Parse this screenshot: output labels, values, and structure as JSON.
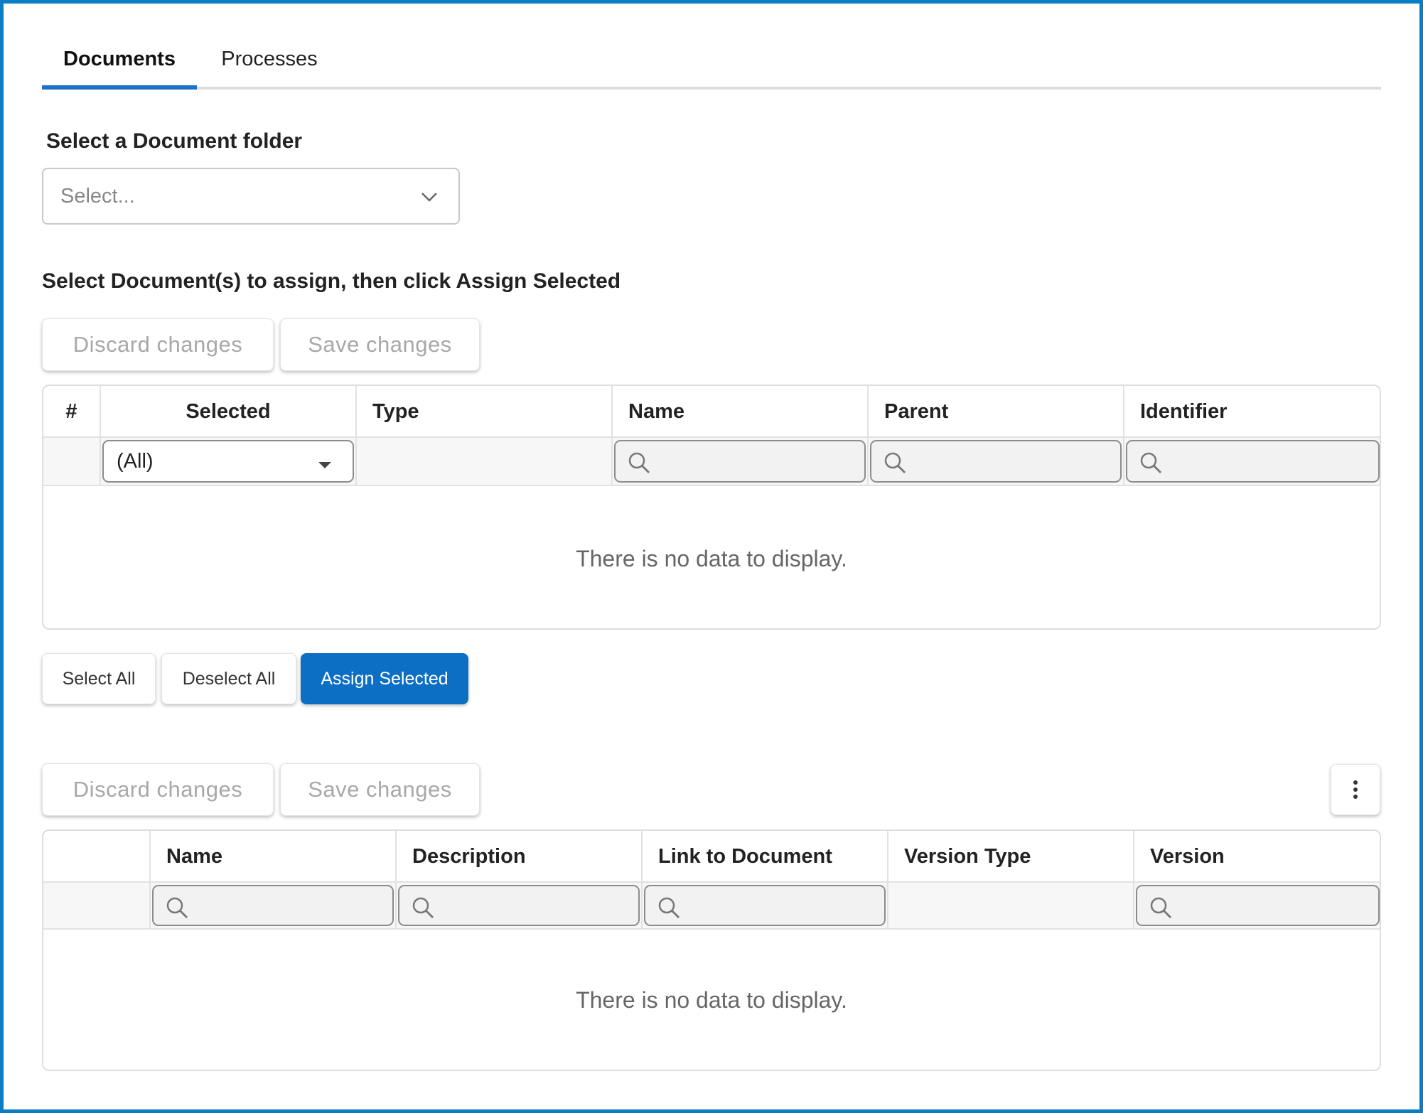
{
  "tabs": [
    {
      "label": "Documents",
      "active": true
    },
    {
      "label": "Processes",
      "active": false
    }
  ],
  "folder": {
    "label": "Select a Document folder",
    "placeholder": "Select..."
  },
  "instruction": "Select Document(s) to assign, then click Assign Selected",
  "top_grid": {
    "toolbar": {
      "discard_label": "Discard changes",
      "save_label": "Save changes"
    },
    "columns": [
      "#",
      "Selected",
      "Type",
      "Name",
      "Parent",
      "Identifier"
    ],
    "selected_filter_value": "(All)",
    "empty_text": "There is no data to display."
  },
  "selection_buttons": {
    "select_all": "Select All",
    "deselect_all": "Deselect All",
    "assign_selected": "Assign Selected"
  },
  "bottom_grid": {
    "toolbar": {
      "discard_label": "Discard changes",
      "save_label": "Save changes"
    },
    "columns": [
      "",
      "Name",
      "Description",
      "Link to Document",
      "Version Type",
      "Version"
    ],
    "empty_text": "There is no data to display."
  },
  "colors": {
    "accent": "#1a73c8",
    "primary_button": "#0d6fc4",
    "frame_border": "#0a7ec2"
  },
  "icons": {
    "folder_select": "chevron-down-icon",
    "filter": "search-icon",
    "grid_menu": "more-vertical-icon"
  }
}
